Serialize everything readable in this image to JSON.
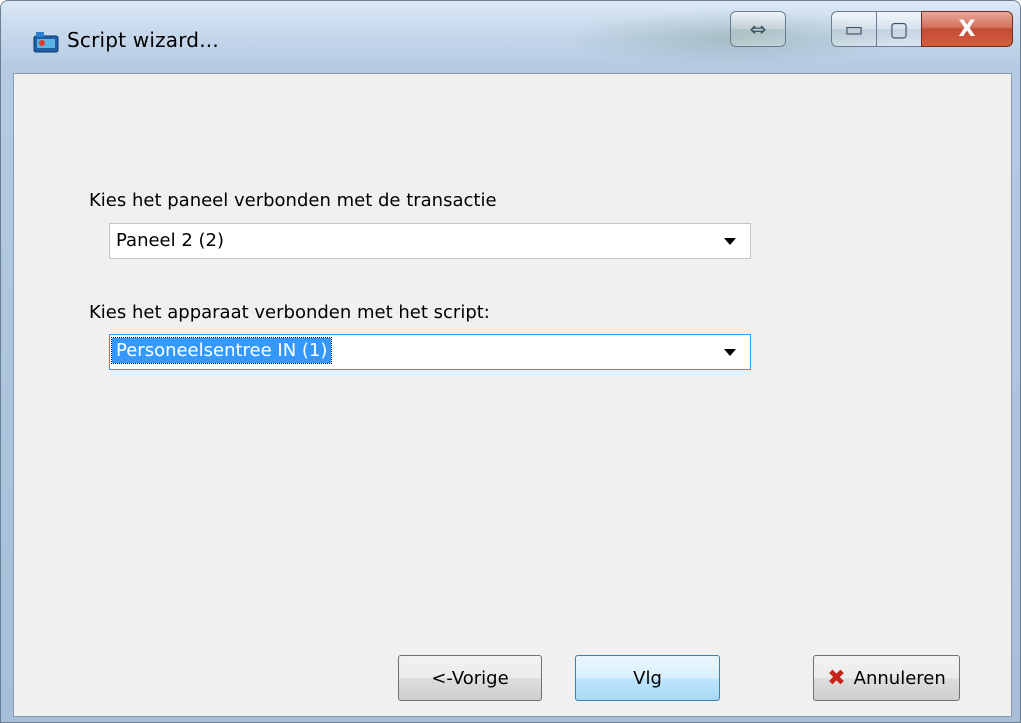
{
  "window": {
    "title": "Script wizard...",
    "controls": {
      "resize_glyph": "⇔",
      "minimize_glyph": "▭",
      "maximize_glyph": "▢",
      "close_glyph": "X"
    }
  },
  "form": {
    "panel_label": "Kies het paneel verbonden met de transactie",
    "panel_value": "Paneel 2  (2)",
    "device_label": "Kies het apparaat verbonden met het script:",
    "device_value": "Personeelsentree IN  (1)"
  },
  "buttons": {
    "previous": "<-Vorige",
    "next": "Vlg",
    "cancel": "Annuleren"
  },
  "colors": {
    "selection": "#3399ff",
    "cancel_icon": "#c8241e"
  }
}
